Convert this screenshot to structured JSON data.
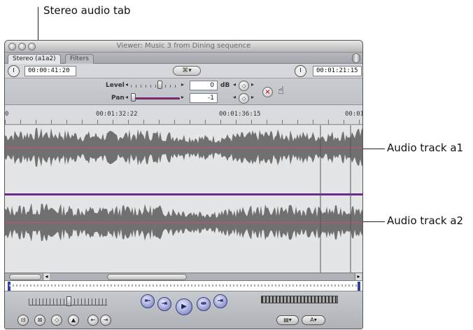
{
  "callouts": {
    "stereo_tab": "Stereo audio tab",
    "track_a1": "Audio track a1",
    "track_a2": "Audio track a2"
  },
  "window": {
    "title": "Viewer: Music 3 from Dining sequence"
  },
  "tabs": [
    {
      "label": "Stereo (a1a2)",
      "active": true
    },
    {
      "label": "Filters",
      "active": false
    }
  ],
  "timecode": {
    "duration": "00:00:41:20",
    "current": "00:01:21:15",
    "center_button": "⌘▾"
  },
  "controls": {
    "level_label": "Level",
    "level_value": "0",
    "level_unit": "dB",
    "pan_label": "Pan",
    "pan_value": "-1"
  },
  "ruler": {
    "labels": [
      "0",
      "00:01:32:22",
      "00:01:36:15",
      "00:01:"
    ]
  },
  "icons": {
    "clock": "clock-icon",
    "hand": "hand-grab-icon",
    "reset": "reset-x-icon",
    "keyframe": "keyframe-diamond-icon"
  },
  "colors": {
    "accent": "#7a2a6e",
    "waveform": "#707070",
    "level_line": "#d0508a",
    "divider": "#6a2a8a"
  }
}
